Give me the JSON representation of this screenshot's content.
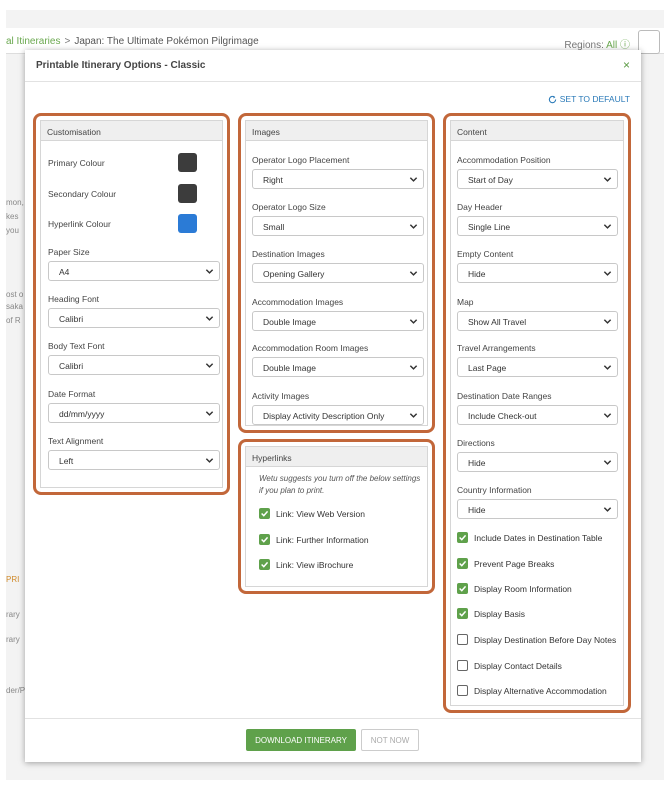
{
  "background": {
    "breadcrumb": {
      "parent": "al Itineraries",
      "separator": ">",
      "current": "Japan: The Ultimate Pokémon Pilgrimage"
    },
    "regions": {
      "label": "Regions:",
      "value": "All"
    },
    "fragments": [
      "mon,",
      "kes",
      "you",
      "ost o",
      "saka",
      "of R",
      "PRI",
      "rary",
      "rary",
      "der/P"
    ]
  },
  "modal": {
    "title": "Printable Itinerary Options - Classic",
    "close": "×",
    "set_default": "SET TO DEFAULT",
    "customisation": {
      "heading": "Customisation",
      "colours": [
        {
          "label": "Primary Colour",
          "color": "#3c3c3c"
        },
        {
          "label": "Secondary Colour",
          "color": "#3c3c3c"
        },
        {
          "label": "Hyperlink Colour",
          "color": "#2b7bd6"
        }
      ],
      "fields": [
        {
          "label": "Paper Size",
          "value": "A4"
        },
        {
          "label": "Heading Font",
          "value": "Calibri"
        },
        {
          "label": "Body Text Font",
          "value": "Calibri"
        },
        {
          "label": "Date Format",
          "value": "dd/mm/yyyy"
        },
        {
          "label": "Text Alignment",
          "value": "Left"
        }
      ]
    },
    "images": {
      "heading": "Images",
      "fields": [
        {
          "label": "Operator Logo Placement",
          "value": "Right"
        },
        {
          "label": "Operator Logo Size",
          "value": "Small"
        },
        {
          "label": "Destination Images",
          "value": "Opening Gallery"
        },
        {
          "label": "Accommodation Images",
          "value": "Double Image"
        },
        {
          "label": "Accommodation Room Images",
          "value": "Double Image"
        },
        {
          "label": "Activity Images",
          "value": "Display Activity Description Only"
        }
      ]
    },
    "hyperlinks": {
      "heading": "Hyperlinks",
      "note": "Wetu suggests you turn off the below settings if you plan to print.",
      "options": [
        {
          "label": "Link: View Web Version",
          "checked": true
        },
        {
          "label": "Link: Further Information",
          "checked": true
        },
        {
          "label": "Link: View iBrochure",
          "checked": true
        }
      ]
    },
    "content": {
      "heading": "Content",
      "fields": [
        {
          "label": "Accommodation Position",
          "value": "Start of Day"
        },
        {
          "label": "Day Header",
          "value": "Single Line"
        },
        {
          "label": "Empty Content",
          "value": "Hide"
        },
        {
          "label": "Map",
          "value": "Show All Travel"
        },
        {
          "label": "Travel Arrangements",
          "value": "Last Page"
        },
        {
          "label": "Destination Date Ranges",
          "value": "Include Check-out"
        },
        {
          "label": "Directions",
          "value": "Hide"
        },
        {
          "label": "Country Information",
          "value": "Hide"
        }
      ],
      "options": [
        {
          "label": "Include Dates in Destination Table",
          "checked": true
        },
        {
          "label": "Prevent Page Breaks",
          "checked": true
        },
        {
          "label": "Display Room Information",
          "checked": true
        },
        {
          "label": "Display Basis",
          "checked": true
        },
        {
          "label": "Display Destination Before Day Notes",
          "checked": false
        },
        {
          "label": "Display Contact Details",
          "checked": false
        },
        {
          "label": "Display Alternative Accommodation",
          "checked": false
        }
      ]
    },
    "footer": {
      "download": "DOWNLOAD ITINERARY",
      "not_now": "NOT NOW"
    },
    "colors": {
      "accent_green": "#5fa14b",
      "highlight_orange": "#c2673a",
      "link_blue": "#2a7ab8"
    }
  }
}
